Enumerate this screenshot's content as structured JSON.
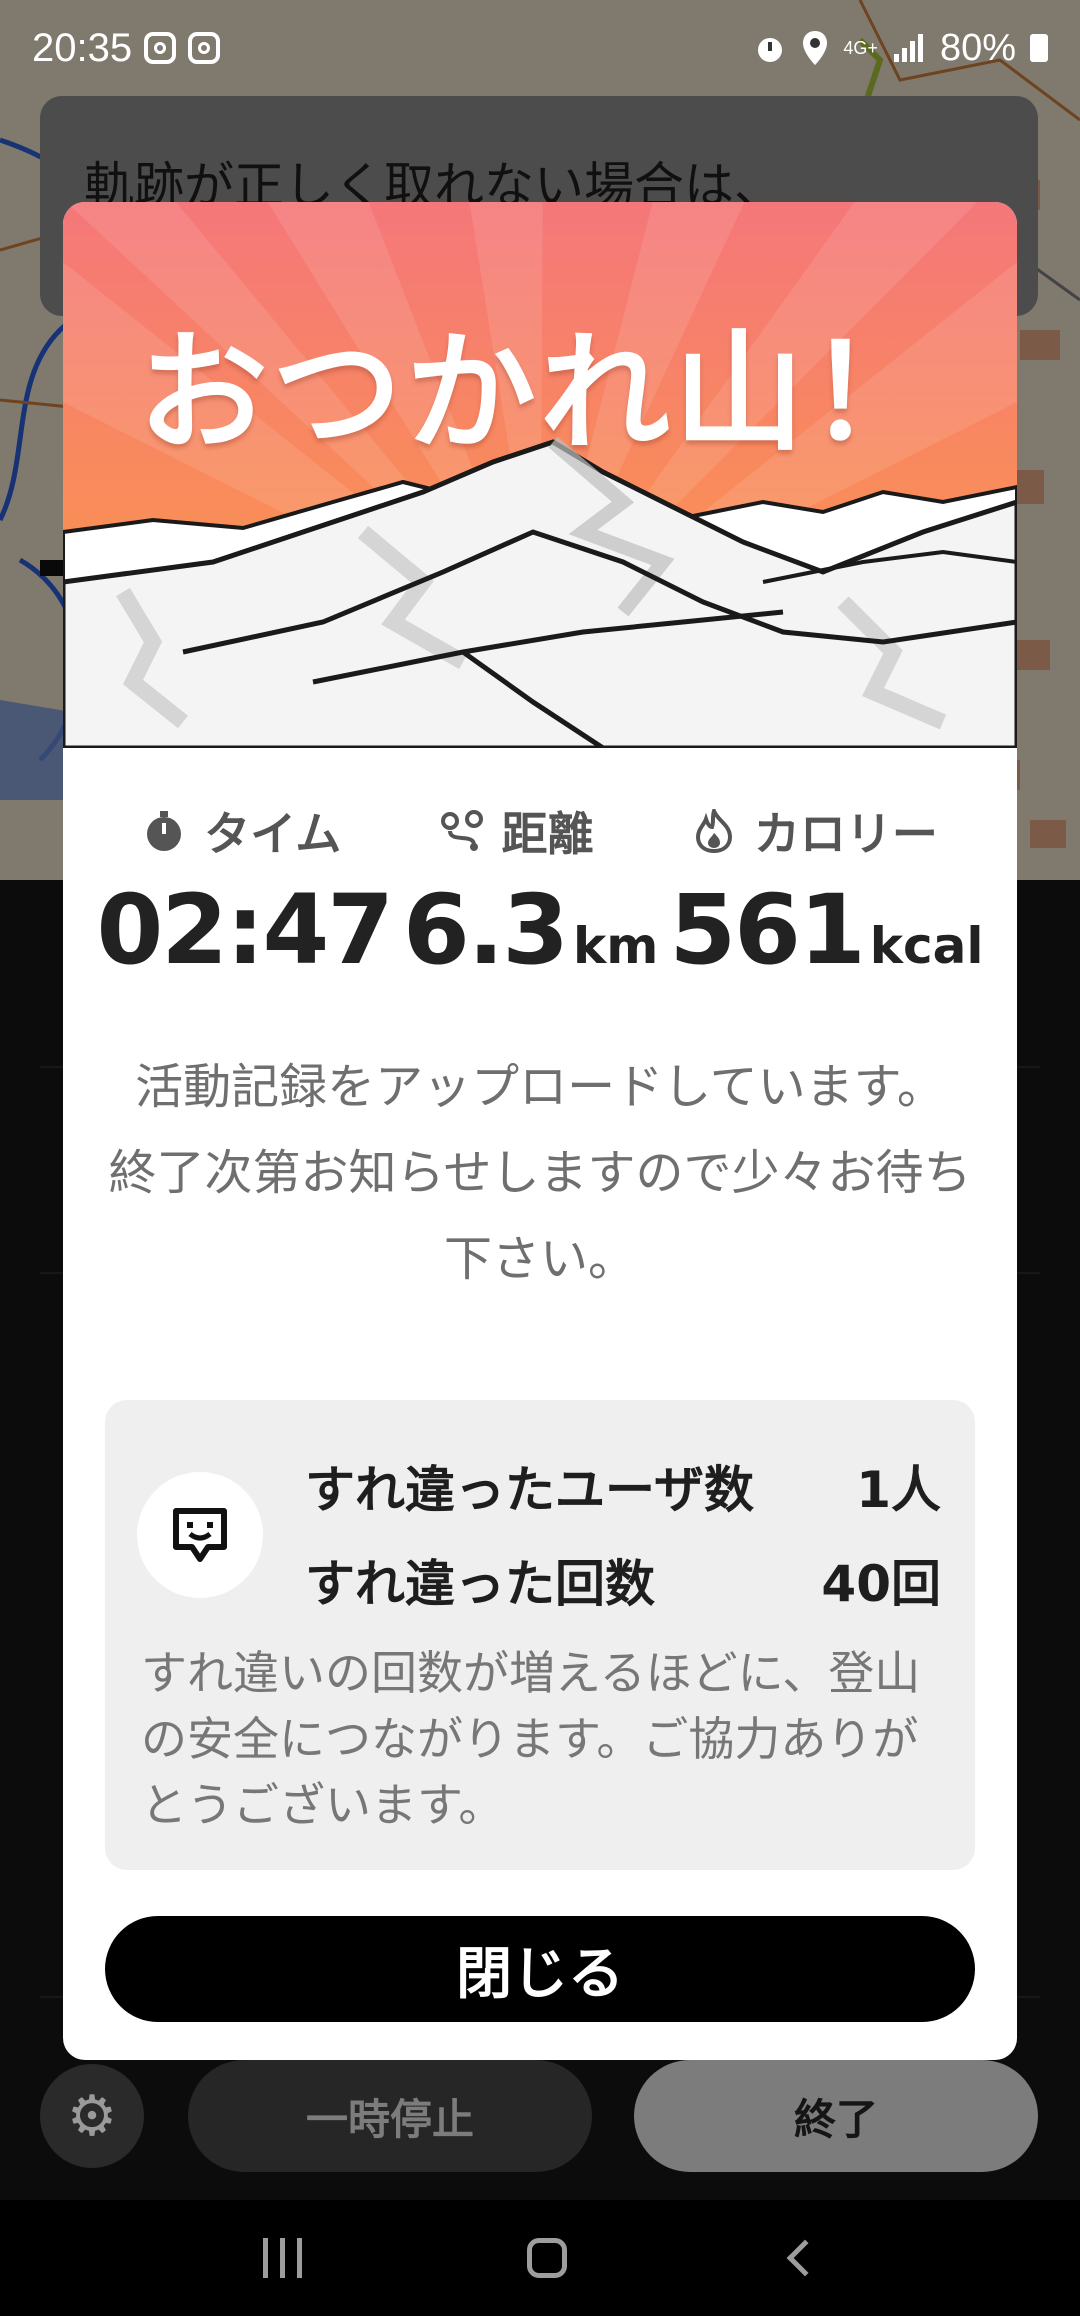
{
  "status_bar": {
    "time": "20:35",
    "network": "4G+",
    "battery": "80%"
  },
  "background": {
    "card_text": "軌跡が正しく取れない場合は、",
    "pause_label": "一時停止",
    "end_label": "終了"
  },
  "modal": {
    "title": "おつかれ山！",
    "stats": [
      {
        "label": "タイム",
        "value": "02:47",
        "unit": "",
        "icon": "stopwatch-icon"
      },
      {
        "label": "距離",
        "value": "6.3",
        "unit": "km",
        "icon": "route-icon"
      },
      {
        "label": "カロリー",
        "value": "561",
        "unit": "kcal",
        "icon": "flame-icon"
      }
    ],
    "message_line1": "活動記録をアップロードしています。",
    "message_line2": "終了次第お知らせしますので少々お待ち下さい。",
    "pass_box": {
      "users_label": "すれ違ったユーザ数",
      "users_value": "1人",
      "count_label": "すれ違った回数",
      "count_value": "40回",
      "note": "すれ違いの回数が増えるほどに、登山の安全につながります。ご協力ありがとうございます。"
    },
    "close_label": "閉じる"
  },
  "colors": {
    "hero_top": "#f5777a",
    "hero_bottom": "#fa9a45",
    "button": "#000000",
    "pass_bg": "#efefef"
  }
}
